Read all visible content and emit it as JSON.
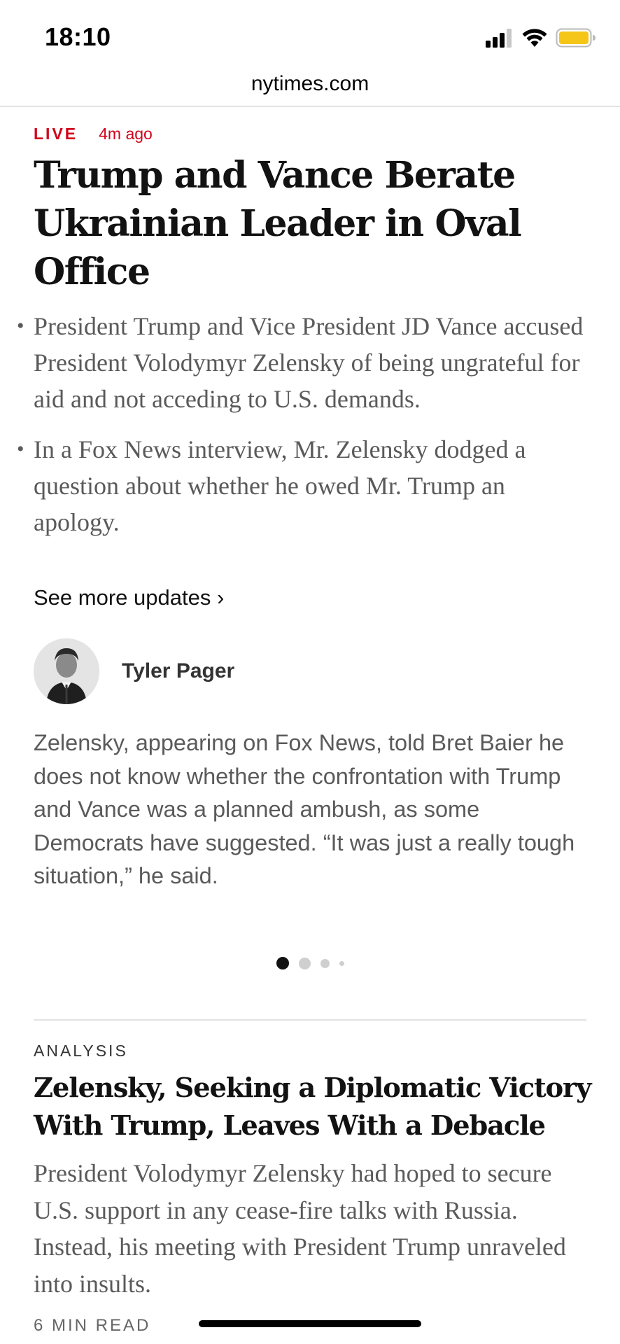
{
  "status_bar": {
    "time": "18:10",
    "icons": [
      "cellular-signal-icon",
      "wifi-icon",
      "battery-icon"
    ],
    "battery_color": "#f5c518"
  },
  "browser": {
    "url": "nytimes.com"
  },
  "live_story": {
    "live_label": "LIVE",
    "updated": "4m ago",
    "headline": "Trump and Vance Berate Ukrainian Leader in Oval Office",
    "bullets": [
      "President Trump and Vice President JD Vance accused President Volodymyr Zelensky of being ungrateful for aid and not acceding to U.S. demands.",
      "In a Fox News interview, Mr. Zelensky dodged a question about whether he owed Mr. Trump an apology."
    ],
    "see_more": "See more updates ›",
    "update": {
      "author": "Tyler Pager",
      "text": "Zelensky, appearing on Fox News, told Bret Baier he does not know whether the confrontation with Trump and Vance was a planned ambush, as some Democrats have suggested. “It was just a really tough situation,” he said."
    },
    "pager": {
      "count": 4,
      "active_index": 0
    }
  },
  "analysis_story": {
    "kicker": "ANALYSIS",
    "headline": "Zelensky, Seeking a Diplomatic Victory With Trump, Leaves With a Debacle",
    "summary": "President Volodymyr Zelensky had hoped to secure U.S. support in any cease-fire talks with Russia. Instead, his meeting with President Trump unraveled into insults.",
    "read_time": "6 MIN READ"
  },
  "colors": {
    "live_red": "#d0021b",
    "headline_text": "#121212",
    "body_gray": "#5a5a5a",
    "divider": "#e2e2e2"
  }
}
